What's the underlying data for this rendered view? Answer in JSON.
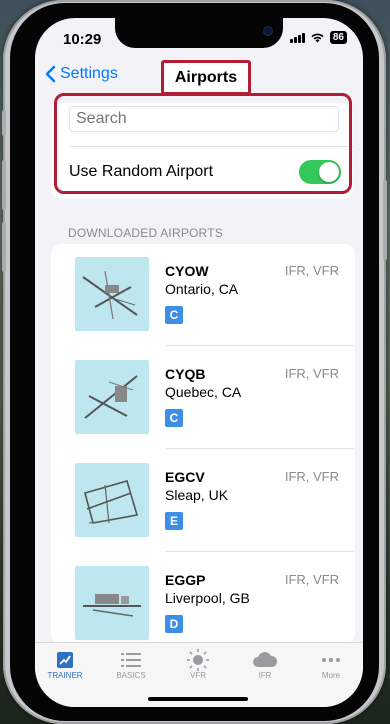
{
  "status": {
    "time": "10:29",
    "battery": "86"
  },
  "nav": {
    "back_label": "Settings",
    "title": "Airports"
  },
  "search": {
    "placeholder": "Search"
  },
  "random": {
    "label": "Use Random Airport",
    "enabled": true
  },
  "section_header": "DOWNLOADED AIRPORTS",
  "airports": [
    {
      "code": "CYOW",
      "location": "Ontario, CA",
      "rules": "IFR, VFR",
      "class": "C"
    },
    {
      "code": "CYQB",
      "location": "Quebec, CA",
      "rules": "IFR, VFR",
      "class": "C"
    },
    {
      "code": "EGCV",
      "location": "Sleap, UK",
      "rules": "IFR, VFR",
      "class": "E"
    },
    {
      "code": "EGGP",
      "location": "Liverpool, GB",
      "rules": "IFR, VFR",
      "class": "D"
    }
  ],
  "tabs": [
    {
      "label": "TRAINER",
      "icon": "trainer-icon",
      "active": true
    },
    {
      "label": "BASICS",
      "icon": "list-icon",
      "active": false
    },
    {
      "label": "VFR",
      "icon": "sun-icon",
      "active": false
    },
    {
      "label": "IFR",
      "icon": "cloud-icon",
      "active": false
    },
    {
      "label": "More",
      "icon": "more-icon",
      "active": false
    }
  ],
  "colors": {
    "accent": "#007aff",
    "toggle_on": "#34c759",
    "highlight": "#b21e35",
    "badge": "#3d8fe6",
    "tab_active": "#2f6fc4"
  }
}
